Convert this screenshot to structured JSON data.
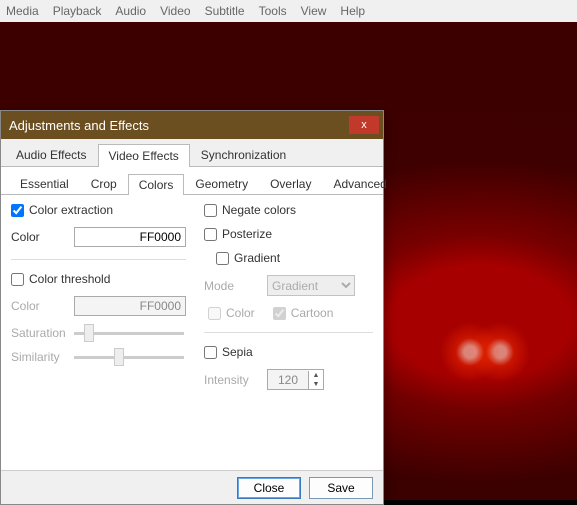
{
  "menubar": [
    "Media",
    "Playback",
    "Audio",
    "Video",
    "Subtitle",
    "Tools",
    "View",
    "Help"
  ],
  "dialog": {
    "title": "Adjustments and Effects",
    "close": "x",
    "tabs": [
      "Audio Effects",
      "Video Effects",
      "Synchronization"
    ],
    "active_tab": "Video Effects",
    "subtabs": [
      "Essential",
      "Crop",
      "Colors",
      "Geometry",
      "Overlay",
      "Advanced"
    ],
    "active_subtab": "Colors",
    "left": {
      "color_extraction": {
        "label": "Color extraction",
        "checked": true
      },
      "color1": {
        "label": "Color",
        "value": "FF0000"
      },
      "color_threshold": {
        "label": "Color threshold",
        "checked": false
      },
      "color2": {
        "label": "Color",
        "value": "FF0000"
      },
      "saturation": {
        "label": "Saturation",
        "value": 10
      },
      "similarity": {
        "label": "Similarity",
        "value": 40
      }
    },
    "right": {
      "negate": {
        "label": "Negate colors",
        "checked": false
      },
      "posterize": {
        "label": "Posterize",
        "checked": false
      },
      "gradient": {
        "label": "Gradient",
        "checked": false
      },
      "mode": {
        "label": "Mode",
        "value": "Gradient"
      },
      "grad_color": {
        "label": "Color",
        "checked": false
      },
      "grad_cartoon": {
        "label": "Cartoon",
        "checked": true
      },
      "sepia": {
        "label": "Sepia",
        "checked": false
      },
      "intensity": {
        "label": "Intensity",
        "value": "120"
      }
    },
    "buttons": {
      "close": "Close",
      "save": "Save"
    }
  }
}
